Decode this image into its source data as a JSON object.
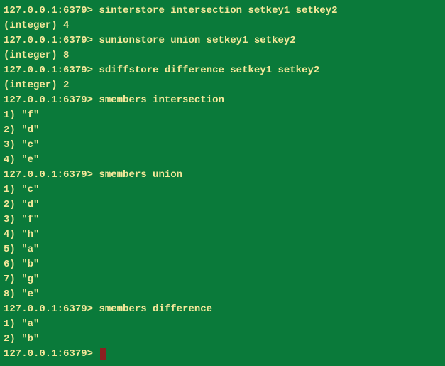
{
  "prompt": "127.0.0.1:6379>",
  "commands": {
    "c1": "sinterstore intersection setkey1 setkey2",
    "r1": "(integer) 4",
    "c2": "sunionstore union setkey1 setkey2",
    "r2": "(integer) 8",
    "c3": "sdiffstore difference setkey1 setkey2",
    "r3": "(integer) 2",
    "c4": "smembers intersection",
    "r4_1": "1) \"f\"",
    "r4_2": "2) \"d\"",
    "r4_3": "3) \"c\"",
    "r4_4": "4) \"e\"",
    "c5": "smembers union",
    "r5_1": "1) \"c\"",
    "r5_2": "2) \"d\"",
    "r5_3": "3) \"f\"",
    "r5_4": "4) \"h\"",
    "r5_5": "5) \"a\"",
    "r5_6": "6) \"b\"",
    "r5_7": "7) \"g\"",
    "r5_8": "8) \"e\"",
    "c6": "smembers difference",
    "r6_1": "1) \"a\"",
    "r6_2": "2) \"b\""
  }
}
